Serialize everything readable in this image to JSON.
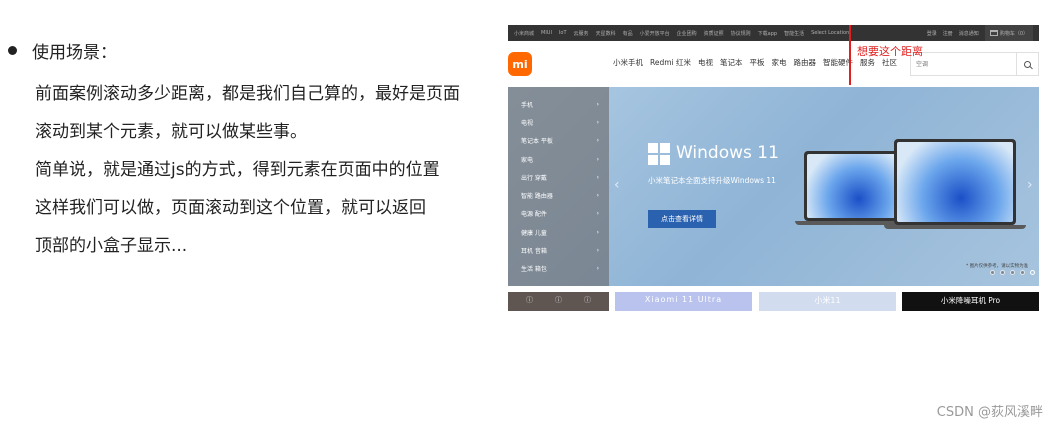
{
  "bullet": {
    "title": "使用场景："
  },
  "paragraphs": [
    "前面案例滚动多少距离，都是我们自己算的，最好是页面",
    "滚动到某个元素，就可以做某些事。",
    "简单说，就是通过js的方式，得到元素在页面中的位置",
    "这样我们可以做，页面滚动到这个位置，就可以返回",
    "顶部的小盒子显示..."
  ],
  "screenshot": {
    "topbar_links": [
      "小米商城",
      "MIUI",
      "IoT",
      "云服务",
      "天星数科",
      "有品",
      "小爱开放平台",
      "企业团购",
      "资质证照",
      "协议规则",
      "下载app",
      "智能生活",
      "Select Location"
    ],
    "topbar_right": [
      "登录",
      "注册",
      "消息通知"
    ],
    "cart_label": "购物车（0）",
    "logo_text": "mi",
    "nav_items": [
      "小米手机",
      "Redmi 红米",
      "电视",
      "笔记本",
      "平板",
      "家电",
      "路由器",
      "智能硬件",
      "服务",
      "社区"
    ],
    "search_placeholder": "空调",
    "annotation": "想要这个距离",
    "category_items": [
      "手机",
      "电视",
      "笔记本 平板",
      "家电",
      "出行 穿戴",
      "智能 路由器",
      "电源 配件",
      "健康 儿童",
      "耳机 音箱",
      "生活 箱包"
    ],
    "banner": {
      "title": "Windows 11",
      "subtitle": "小米笔记本全面支持升级Windows 11",
      "button": "点击查看详情",
      "note": "* 图片仅供参考，请以实物为准",
      "dot_count": 5,
      "active_dot": 4
    },
    "promos": [
      "ⓘ",
      "Xiaomi 11 Ultra",
      "小米11",
      "小米降噪耳机 Pro"
    ]
  },
  "watermark": "CSDN @荻风溪畔",
  "colors": {
    "accent": "#ff6700",
    "annotation": "#e02020",
    "button": "#2a62b0"
  }
}
